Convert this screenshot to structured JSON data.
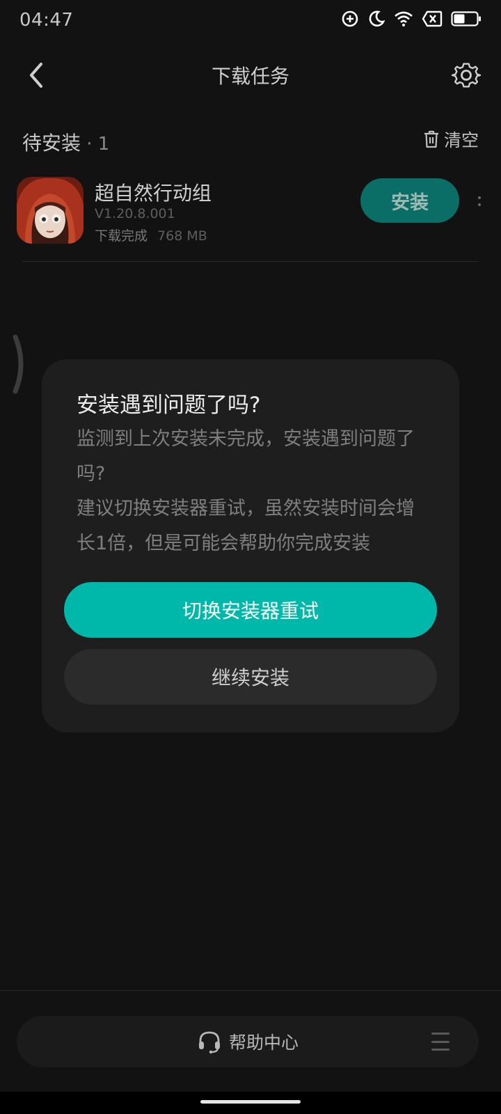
{
  "status_bar": {
    "time": "04:47",
    "icons": [
      "data-saver-icon",
      "moon-icon",
      "wifi-icon",
      "no-sim-icon",
      "battery-icon"
    ]
  },
  "header": {
    "title": "下载任务",
    "back_icon": "chevron-left-icon",
    "settings_icon": "gear-icon"
  },
  "section": {
    "title": "待安装",
    "count": " · 1",
    "clear_label": "清空"
  },
  "download_item": {
    "name": "超自然行动组",
    "version": "V1.20.8.001",
    "status": "下载完成",
    "size": "768 MB",
    "install_label": "安装"
  },
  "dialog": {
    "title": "安装遇到问题了吗?",
    "message": "监测到上次安装未完成，安装遇到问题了吗?\n建议切换安装器重试，虽然安装时间会增长1倍，但是可能会帮助你完成安装",
    "primary_button": "切换安装器重试",
    "secondary_button": "继续安装"
  },
  "bottom": {
    "help_label": "帮助中心"
  },
  "colors": {
    "background": "#121212",
    "dialog_bg": "#1e1e1e",
    "accent": "#00b8a9",
    "install_btn": "#0a6e66"
  }
}
